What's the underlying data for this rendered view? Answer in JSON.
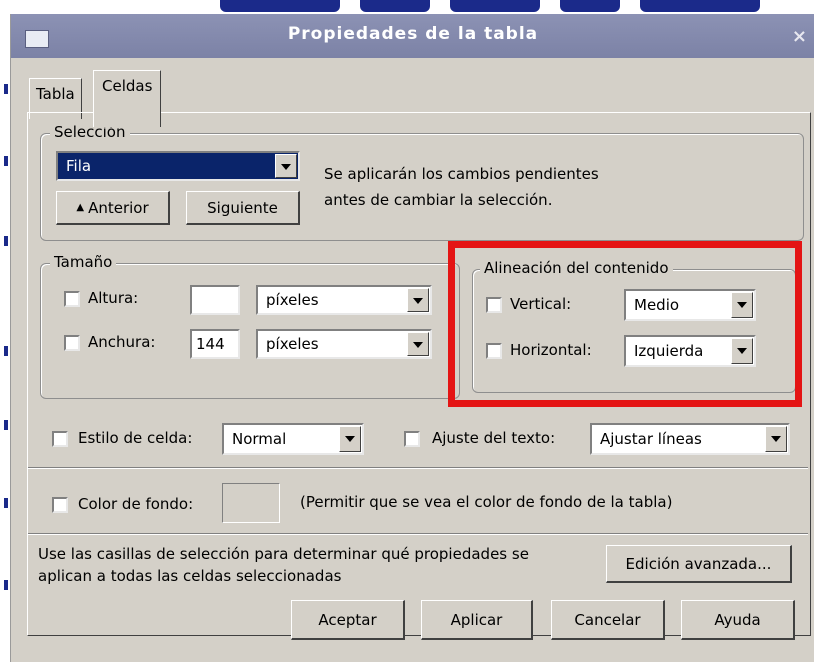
{
  "window": {
    "title": "Propiedades de la tabla",
    "close_glyph": "×"
  },
  "tabs": [
    {
      "label": "Tabla"
    },
    {
      "label": "Celdas"
    }
  ],
  "seleccion": {
    "legend": "Selección",
    "combo_value": "Fila",
    "prev_button": "Anterior",
    "next_button": "Siguiente",
    "info_line1": "Se aplicarán los cambios pendientes",
    "info_line2": "antes de cambiar la selección."
  },
  "tamano": {
    "legend": "Tamaño",
    "altura_label": "Altura:",
    "altura_value": "",
    "altura_unit": "píxeles",
    "anchura_label": "Anchura:",
    "anchura_value": "144",
    "anchura_unit": "píxeles"
  },
  "alineacion": {
    "legend": "Alineación del contenido",
    "vertical_label": "Vertical:",
    "vertical_value": "Medio",
    "horizontal_label": "Horizontal:",
    "horizontal_value": "Izquierda"
  },
  "estilo": {
    "label": "Estilo de celda:",
    "value": "Normal"
  },
  "ajuste": {
    "label": "Ajuste del texto:",
    "value": "Ajustar líneas"
  },
  "color": {
    "label": "Color de fondo:",
    "note": "(Permitir que se vea el color de fondo de la tabla)"
  },
  "info": {
    "line1": "Use las casillas de selección para determinar qué propiedades se",
    "line2": "aplican a todas las celdas seleccionadas",
    "advanced_button": "Edición avanzada..."
  },
  "footer": {
    "ok": "Aceptar",
    "apply": "Aplicar",
    "cancel": "Cancelar",
    "help": "Ayuda"
  },
  "colors": {
    "highlight_border": "#e41414",
    "selection_bg": "#0a246a",
    "dialog_bg": "#d4d0c8",
    "titlebar": "#8088aa"
  }
}
